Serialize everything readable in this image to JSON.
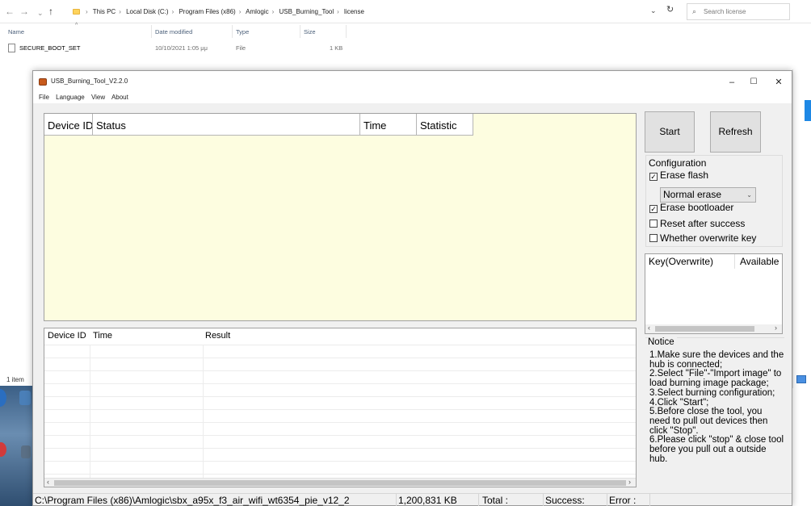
{
  "explorer": {
    "nav": {
      "back": "←",
      "forward": "→",
      "recent": "⌄",
      "up": "↑"
    },
    "breadcrumb": [
      "This PC",
      "Local Disk (C:)",
      "Program Files (x86)",
      "Amlogic",
      "USB_Burning_Tool",
      "license"
    ],
    "breadcrumb_sep": "›",
    "search_placeholder": "Search license",
    "columns": {
      "name": "Name",
      "date": "Date modified",
      "type": "Type",
      "size": "Size"
    },
    "file": {
      "name": "SECURE_BOOT_SET",
      "date": "10/10/2021 1:05 μμ",
      "type": "File",
      "size": "1 KB"
    },
    "item_count": "1 item"
  },
  "tool": {
    "title": "USB_Burning_Tool_V2.2.0",
    "window_controls": {
      "minimize": "–",
      "maximize": "☐",
      "close": "✕"
    },
    "menu": [
      "File",
      "Language",
      "View",
      "About"
    ],
    "device_table": {
      "headers": [
        "Device ID",
        "Status",
        "Time",
        "Statistic"
      ]
    },
    "result_table": {
      "headers": [
        "Device ID",
        "Time",
        "Result"
      ]
    },
    "buttons": {
      "start": "Start",
      "refresh": "Refresh"
    },
    "configuration": {
      "title": "Configuration",
      "erase_flash": {
        "label": "Erase flash",
        "checked": true
      },
      "erase_mode": "Normal erase",
      "erase_bootloader": {
        "label": "Erase bootloader",
        "checked": true
      },
      "reset_after_success": {
        "label": "Reset after success",
        "checked": false
      },
      "overwrite_key": {
        "label": "Whether overwrite key",
        "checked": false
      }
    },
    "key_list": {
      "col1": "Key(Overwrite)",
      "col2": "Available"
    },
    "notice": {
      "title": "Notice",
      "lines": [
        "1.Make sure the devices and the hub is connected;",
        "2.Select \"File\"-\"Import image\" to load burning image package;",
        "3.Select burning configuration;",
        "4.Click \"Start\";",
        "5.Before close the tool, you need to pull out devices then click \"Stop\".",
        "6.Please click \"stop\" & close tool before you pull out a outside hub."
      ]
    },
    "status": {
      "image_path": "C:\\Program Files (x86)\\Amlogic\\sbx_a95x_f3_air_wifi_wt6354_pie_v12_2",
      "image_size": "1,200,831 KB",
      "total": "Total :",
      "success": "Success:",
      "error": "Error :"
    }
  }
}
